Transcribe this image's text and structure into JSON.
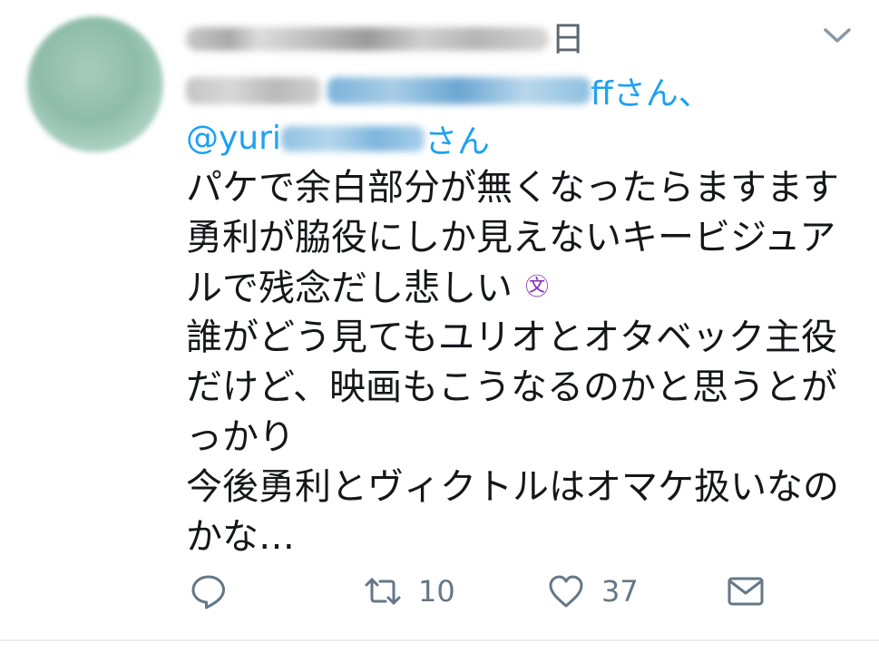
{
  "tweet": {
    "header": {
      "date_suffix": "日"
    },
    "reply": {
      "mention1_suffix": "ffさん、",
      "mention2_prefix": "@yuri",
      "mention2_suffix": "さん"
    },
    "body_lines": [
      "パケで余白部分が無くなったらますます",
      "勇利が脇役にしか見えないキービジュア",
      "ルで残念だし悲しい",
      "誰がどう見てもユリオとオタベック主役",
      "だけど、映画もこうなるのかと思うとが",
      "っかり",
      "今後勇利とヴィクトルはオマケ扱いなの",
      "かな…"
    ],
    "emoji": "㉆",
    "emoji_name": "crying-face-emoji",
    "actions": {
      "reply_icon": "reply-icon",
      "retweet_icon": "retweet-icon",
      "retweet_count": "10",
      "like_icon": "heart-icon",
      "like_count": "37",
      "dm_icon": "envelope-icon"
    },
    "colors": {
      "accent": "#1da1f2",
      "text": "#14171a",
      "muted": "#657786",
      "emoji": "#8b2fb8"
    }
  }
}
